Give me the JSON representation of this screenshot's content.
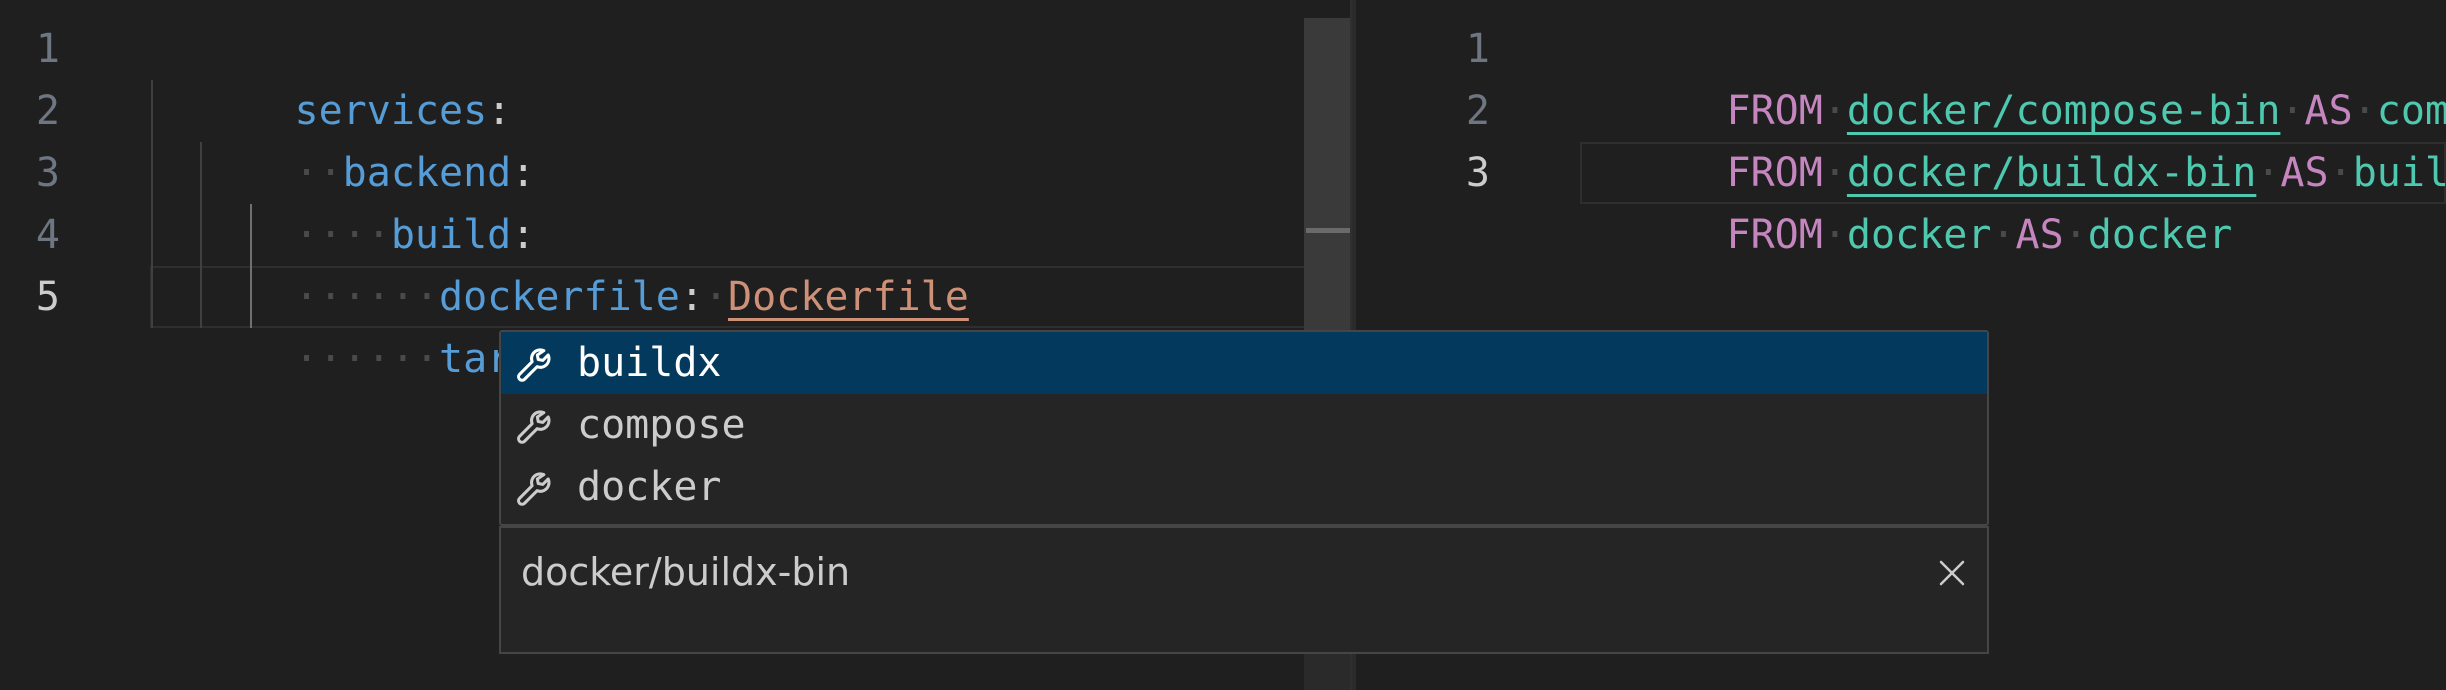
{
  "left_editor": {
    "line_numbers": [
      "1",
      "2",
      "3",
      "4",
      "5"
    ],
    "active_line": "5",
    "lines": [
      {
        "key": "services",
        "colon": ":"
      },
      {
        "key": "backend",
        "colon": ":"
      },
      {
        "key": "build",
        "colon": ":"
      },
      {
        "key": "dockerfile",
        "colon": ":",
        "value": "Dockerfile"
      },
      {
        "key": "target",
        "colon": ":"
      }
    ]
  },
  "right_editor": {
    "line_numbers": [
      "1",
      "2",
      "3"
    ],
    "active_line": "3",
    "lines": [
      {
        "from": "FROM",
        "image": "docker/compose-bin",
        "as": "AS",
        "alias": "compose"
      },
      {
        "from": "FROM",
        "image": "docker/buildx-bin",
        "as": "AS",
        "alias": "buildx"
      },
      {
        "from": "FROM",
        "image": "docker",
        "as": "AS",
        "alias": "docker"
      }
    ]
  },
  "suggest": {
    "items": [
      {
        "label": "buildx",
        "icon": "wrench-icon",
        "selected": true
      },
      {
        "label": "compose",
        "icon": "wrench-icon",
        "selected": false
      },
      {
        "label": "docker",
        "icon": "wrench-icon",
        "selected": false
      }
    ],
    "details": {
      "text": "docker/buildx-bin",
      "close_icon": "close-icon"
    }
  },
  "colors": {
    "key": "#569cd6",
    "string": "#ce9178",
    "keyword": "#c586c0",
    "identifier": "#4ec9b0",
    "selected_bg": "#04395e",
    "editor_bg": "#1f1f1f"
  }
}
